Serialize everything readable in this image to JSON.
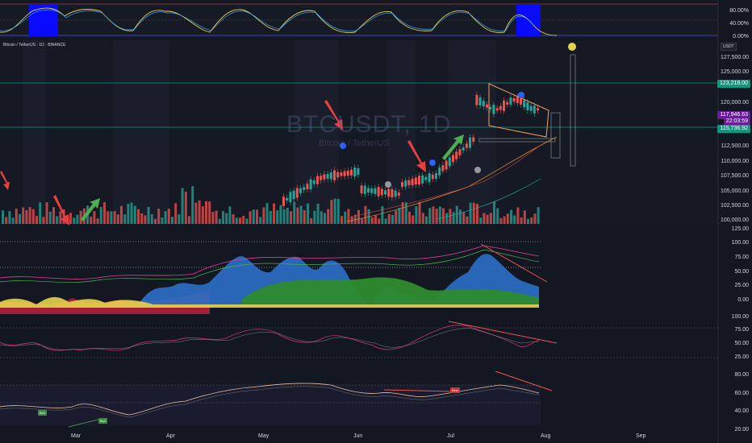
{
  "legend": {
    "text": "Bitcoin / TetherUS · 1D · BINANCE"
  },
  "symbol_box": {
    "text": "USDT"
  },
  "watermark": {
    "symbol": "BTCUSDT, 1D",
    "name": "Bitcoin / TetherUS"
  },
  "osc_top_axis": [
    "80.00%",
    "40.00%",
    "0.00%"
  ],
  "price_axis": [
    "127,500.00",
    "125,000.00",
    "120,000.00",
    "112,500.00",
    "110,000.00",
    "107,500.00",
    "105,000.00",
    "102,500.00",
    "100,000.00"
  ],
  "price_tags": {
    "resistance": "123,218.00",
    "current_price": "117,946.63",
    "countdown": "22:03:59",
    "support": "115,736.92"
  },
  "osc2_axis": [
    "125.00",
    "100.00",
    "75.00",
    "50.00",
    "25.00",
    "0.00"
  ],
  "rsi_axis": [
    "100.00",
    "75.00",
    "50.00",
    "25.00"
  ],
  "osc4_axis": [
    "80.00",
    "60.00",
    "40.00",
    "20.00"
  ],
  "months": [
    "Mar",
    "Apr",
    "May",
    "Jun",
    "Jul",
    "Aug",
    "Sep"
  ],
  "signals": {
    "bear": "Bear",
    "bull1": "Bull",
    "bull2": "Bull"
  },
  "colors": {
    "background": "#131722",
    "up": "#26a69a",
    "down": "#ef5350",
    "blue_band": "#0000ff",
    "channel": "#f7a35c",
    "support_line": "#089981"
  }
}
